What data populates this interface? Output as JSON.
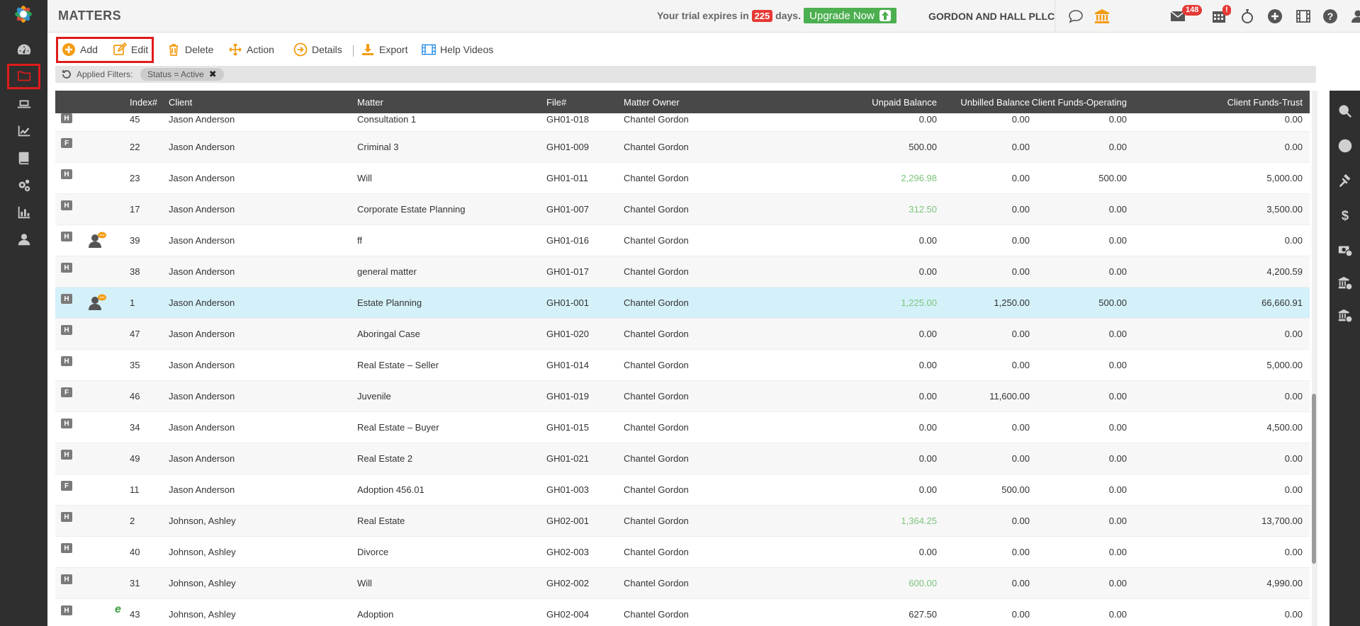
{
  "app": {
    "page_title": "MATTERS",
    "trial_prefix": "Your trial expires in",
    "trial_days": "225",
    "trial_suffix": "days.",
    "upgrade_label": "Upgrade Now",
    "firm_name": "GORDON AND HALL PLLC",
    "mail_badge": "148",
    "calendar_badge": "!"
  },
  "left_nav": [
    {
      "icon": "dashboard-icon"
    },
    {
      "icon": "folder-icon",
      "active": true
    },
    {
      "icon": "laptop-icon"
    },
    {
      "icon": "chart-line-icon"
    },
    {
      "icon": "book-icon"
    },
    {
      "icon": "gears-icon"
    },
    {
      "icon": "bar-chart-icon"
    },
    {
      "icon": "user-icon"
    }
  ],
  "toolbar": {
    "add_label": "Add",
    "edit_label": "Edit",
    "delete_label": "Delete",
    "action_label": "Action",
    "details_label": "Details",
    "export_label": "Export",
    "help_label": "Help Videos"
  },
  "filters": {
    "label": "Applied Filters:",
    "chip": "Status = Active"
  },
  "table": {
    "columns": {
      "index": "Index#",
      "client": "Client",
      "matter": "Matter",
      "file": "File#",
      "owner": "Matter Owner",
      "unpaid": "Unpaid Balance",
      "unbilled": "Unbilled Balance",
      "operating": "Client Funds-Operating",
      "trust": "Client Funds-Trust"
    },
    "rows": [
      {
        "type": "H",
        "icon": "",
        "index": "45",
        "client": "Jason Anderson",
        "matter": "Consultation 1",
        "file": "GH01-018",
        "owner": "Chantel Gordon",
        "unpaid": "0.00",
        "unpaid_green": false,
        "unbilled": "0.00",
        "operating": "0.00",
        "trust": "0.00"
      },
      {
        "type": "F",
        "icon": "",
        "index": "22",
        "client": "Jason Anderson",
        "matter": "Criminal 3",
        "file": "GH01-009",
        "owner": "Chantel Gordon",
        "unpaid": "500.00",
        "unpaid_green": false,
        "unbilled": "0.00",
        "operating": "0.00",
        "trust": "0.00"
      },
      {
        "type": "H",
        "icon": "",
        "index": "23",
        "client": "Jason Anderson",
        "matter": "Will",
        "file": "GH01-011",
        "owner": "Chantel Gordon",
        "unpaid": "2,296.98",
        "unpaid_green": true,
        "unbilled": "0.00",
        "operating": "500.00",
        "trust": "5,000.00"
      },
      {
        "type": "H",
        "icon": "",
        "index": "17",
        "client": "Jason Anderson",
        "matter": "Corporate Estate Planning",
        "file": "GH01-007",
        "owner": "Chantel Gordon",
        "unpaid": "312.50",
        "unpaid_green": true,
        "unbilled": "0.00",
        "operating": "0.00",
        "trust": "3,500.00"
      },
      {
        "type": "H",
        "icon": "user-chat-icon",
        "index": "39",
        "client": "Jason Anderson",
        "matter": "ff",
        "file": "GH01-016",
        "owner": "Chantel Gordon",
        "unpaid": "0.00",
        "unpaid_green": false,
        "unbilled": "0.00",
        "operating": "0.00",
        "trust": "0.00"
      },
      {
        "type": "H",
        "icon": "",
        "index": "38",
        "client": "Jason Anderson",
        "matter": "general matter",
        "file": "GH01-017",
        "owner": "Chantel Gordon",
        "unpaid": "0.00",
        "unpaid_green": false,
        "unbilled": "0.00",
        "operating": "0.00",
        "trust": "4,200.59"
      },
      {
        "type": "H",
        "icon": "user-chat-icon",
        "index": "1",
        "client": "Jason Anderson",
        "matter": "Estate Planning",
        "file": "GH01-001",
        "owner": "Chantel Gordon",
        "unpaid": "1,225.00",
        "unpaid_green": true,
        "unbilled": "1,250.00",
        "operating": "500.00",
        "trust": "66,660.91",
        "selected": true
      },
      {
        "type": "H",
        "icon": "",
        "index": "47",
        "client": "Jason Anderson",
        "matter": "Aboringal Case",
        "file": "GH01-020",
        "owner": "Chantel Gordon",
        "unpaid": "0.00",
        "unpaid_green": false,
        "unbilled": "0.00",
        "operating": "0.00",
        "trust": "0.00"
      },
      {
        "type": "H",
        "icon": "",
        "index": "35",
        "client": "Jason Anderson",
        "matter": "Real Estate – Seller",
        "file": "GH01-014",
        "owner": "Chantel Gordon",
        "unpaid": "0.00",
        "unpaid_green": false,
        "unbilled": "0.00",
        "operating": "0.00",
        "trust": "5,000.00"
      },
      {
        "type": "F",
        "icon": "",
        "index": "46",
        "client": "Jason Anderson",
        "matter": "Juvenile",
        "file": "GH01-019",
        "owner": "Chantel Gordon",
        "unpaid": "0.00",
        "unpaid_green": false,
        "unbilled": "11,600.00",
        "operating": "0.00",
        "trust": "0.00"
      },
      {
        "type": "H",
        "icon": "",
        "index": "34",
        "client": "Jason Anderson",
        "matter": "Real Estate – Buyer",
        "file": "GH01-015",
        "owner": "Chantel Gordon",
        "unpaid": "0.00",
        "unpaid_green": false,
        "unbilled": "0.00",
        "operating": "0.00",
        "trust": "4,500.00"
      },
      {
        "type": "H",
        "icon": "",
        "index": "49",
        "client": "Jason Anderson",
        "matter": "Real Estate 2",
        "file": "GH01-021",
        "owner": "Chantel Gordon",
        "unpaid": "0.00",
        "unpaid_green": false,
        "unbilled": "0.00",
        "operating": "0.00",
        "trust": "0.00"
      },
      {
        "type": "F",
        "icon": "",
        "index": "11",
        "client": "Jason Anderson",
        "matter": "Adoption 456.01",
        "file": "GH01-003",
        "owner": "Chantel Gordon",
        "unpaid": "0.00",
        "unpaid_green": false,
        "unbilled": "500.00",
        "operating": "0.00",
        "trust": "0.00"
      },
      {
        "type": "H",
        "icon": "",
        "index": "2",
        "client": "Johnson, Ashley",
        "matter": "Real Estate",
        "file": "GH02-001",
        "owner": "Chantel Gordon",
        "unpaid": "1,364.25",
        "unpaid_green": true,
        "unbilled": "0.00",
        "operating": "0.00",
        "trust": "13,700.00"
      },
      {
        "type": "H",
        "icon": "",
        "index": "40",
        "client": "Johnson, Ashley",
        "matter": "Divorce",
        "file": "GH02-003",
        "owner": "Chantel Gordon",
        "unpaid": "0.00",
        "unpaid_green": false,
        "unbilled": "0.00",
        "operating": "0.00",
        "trust": "0.00"
      },
      {
        "type": "H",
        "icon": "",
        "index": "31",
        "client": "Johnson, Ashley",
        "matter": "Will",
        "file": "GH02-002",
        "owner": "Chantel Gordon",
        "unpaid": "600.00",
        "unpaid_green": true,
        "unbilled": "0.00",
        "operating": "0.00",
        "trust": "4,990.00"
      },
      {
        "type": "H",
        "icon": "e",
        "index": "43",
        "client": "Johnson, Ashley",
        "matter": "Adoption",
        "file": "GH02-004",
        "owner": "Chantel Gordon",
        "unpaid": "627.50",
        "unpaid_green": false,
        "unbilled": "0.00",
        "operating": "0.00",
        "trust": "0.00"
      }
    ]
  },
  "right_nav": [
    {
      "icon": "search-icon"
    },
    {
      "icon": "clock-icon"
    },
    {
      "icon": "gavel-icon"
    },
    {
      "icon": "dollar-icon"
    },
    {
      "icon": "money-clock-icon"
    },
    {
      "icon": "bank-clock-icon"
    },
    {
      "icon": "bank-clock-icon-2"
    }
  ],
  "colors": {
    "sidebar": "#2f2f2f",
    "header_row": "#484848",
    "selected_row": "#d4f1f9",
    "accent_orange": "#f39c12",
    "upgrade_green": "#4caf50",
    "highlight_red": "#e01b1b",
    "green_value": "#7cc47c"
  }
}
